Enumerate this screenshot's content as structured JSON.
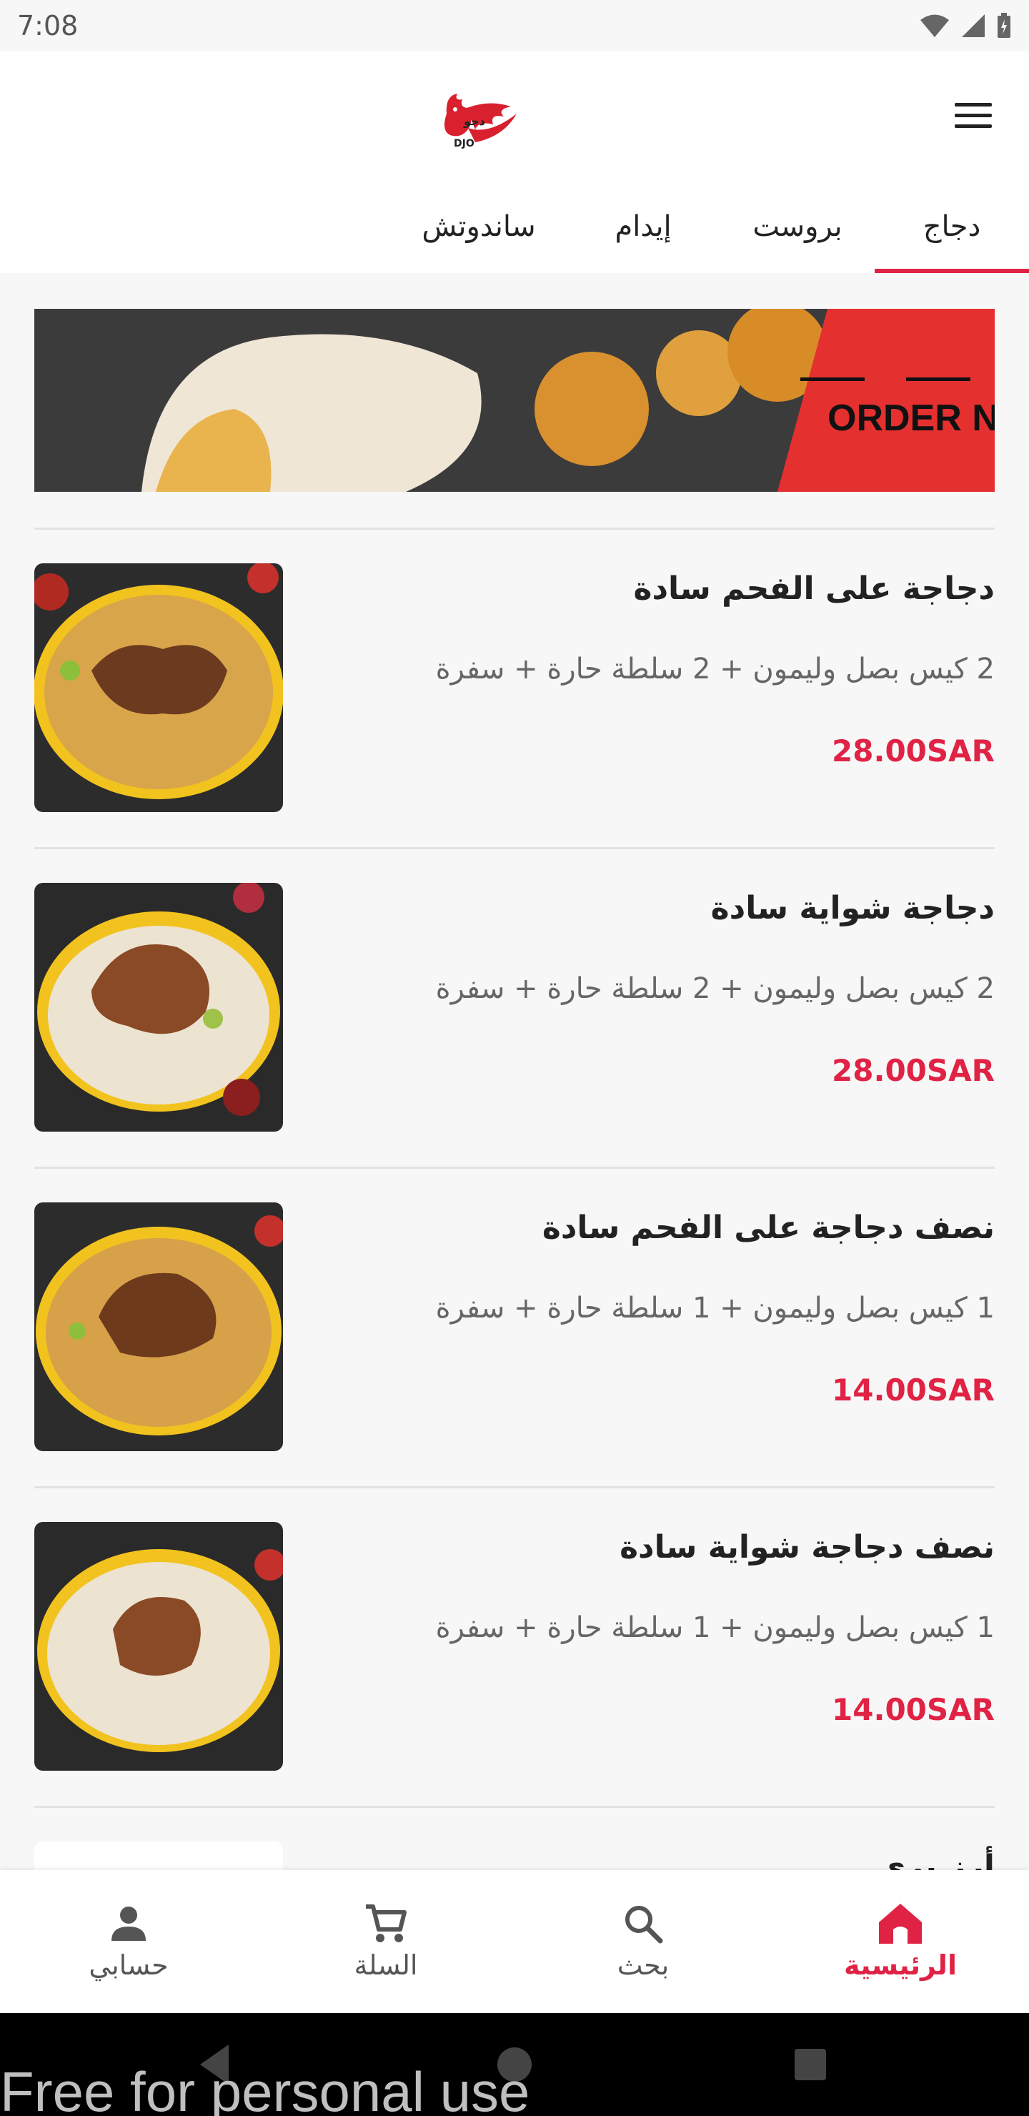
{
  "status_bar": {
    "time": "7:08"
  },
  "header": {
    "logo_text": "DJO",
    "logo_arabic": "دجو",
    "menu_icon": "hamburger-menu-icon"
  },
  "tabs": [
    {
      "label": "دجاج",
      "active": true
    },
    {
      "label": "بروست",
      "active": false
    },
    {
      "label": "إيدام",
      "active": false
    },
    {
      "label": "ساندوتش",
      "active": false
    }
  ],
  "banner": {
    "text": "ORDER NOW"
  },
  "menu_items": [
    {
      "title": "دجاجة على الفحم سادة",
      "description": "2 كيس بصل وليمون + 2 سلطة حارة + سفرة",
      "price": "28.00SAR"
    },
    {
      "title": "دجاجة شواية سادة",
      "description": "2 كيس بصل وليمون + 2 سلطة حارة + سفرة",
      "price": "28.00SAR"
    },
    {
      "title": "نصف دجاجة على الفحم سادة",
      "description": "1 كيس بصل وليمون + 1 سلطة حارة + سفرة",
      "price": "14.00SAR"
    },
    {
      "title": "نصف دجاجة شواية سادة",
      "description": "1 كيس بصل وليمون + 1 سلطة حارة + سفرة",
      "price": "14.00SAR"
    },
    {
      "title": "أرز بري",
      "description": "",
      "price": ""
    }
  ],
  "bottom_nav": [
    {
      "label": "حسابي",
      "icon": "person-icon",
      "active": false
    },
    {
      "label": "السلة",
      "icon": "cart-icon",
      "active": false
    },
    {
      "label": "بحث",
      "icon": "search-icon",
      "active": false
    },
    {
      "label": "الرئيسية",
      "icon": "home-icon",
      "active": true
    }
  ],
  "watermark": "Free for personal use",
  "colors": {
    "accent": "#e02345",
    "background": "#f7f7f7"
  }
}
